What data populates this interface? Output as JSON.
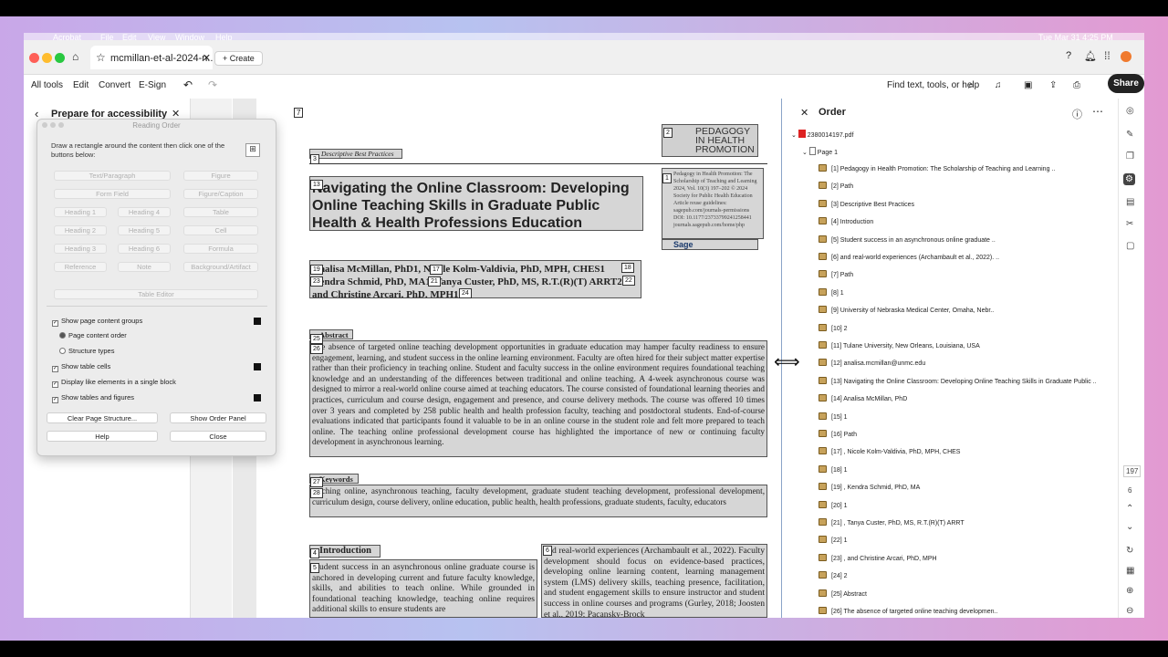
{
  "menubar": {
    "items": [
      "Acrobat",
      "File",
      "Edit",
      "View",
      "Window",
      "Help"
    ],
    "clock": "Tue Mar 31 4:25 PM"
  },
  "tab": {
    "title": "mcmillan-et-al-2024-n...",
    "new_tab": "Create"
  },
  "toolbar": {
    "all_tools": "All tools",
    "edit": "Edit",
    "convert": "Convert",
    "esign": "E-Sign",
    "search": "Find text, tools, or help",
    "share": "Share"
  },
  "left_panel": {
    "title": "Prepare for accessibility"
  },
  "reading_order": {
    "title": "Reading Order",
    "instruction": "Draw a rectangle around the content then click one of the buttons below:",
    "buttons": [
      "Text/Paragraph",
      "Figure",
      "Form Field",
      "Figure/Caption",
      "Heading 1",
      "Heading 4",
      "Table",
      "Heading 2",
      "Heading 5",
      "Cell",
      "Heading 3",
      "Heading 6",
      "Formula",
      "Reference",
      "Note",
      "Background/Artifact"
    ],
    "table_editor": "Table Editor",
    "options": {
      "show_groups": "Show page content groups",
      "content_order": "Page content order",
      "structure_types": "Structure types",
      "show_cells": "Show table cells",
      "display_like": "Display like elements in a single block",
      "show_tables": "Show tables and figures"
    },
    "clear": "Clear Page Structure...",
    "show_order": "Show Order Panel",
    "help": "Help",
    "close": "Close"
  },
  "document": {
    "page_number": "7",
    "best_practices": "Descriptive Best Practices",
    "journal_title": "PEDAGOGY IN HEALTH PROMOTION",
    "journal_info": "Pedagogy in Health Promotion: The Scholarship of Teaching and Learning 2024, Vol. 10(3) 197–202 © 2024 Society for Public Health Education Article reuse guidelines: sagepub.com/journals-permissions DOI: 10.1177/23733799241258441 journals.sagepub.com/home/php",
    "sage": "Sage",
    "title": "Navigating the Online Classroom: Developing Online Teaching Skills in Graduate Public Health & Health Professions Education",
    "authors1": "Analisa McMillan, PhD1, Nicole Kolm-Valdivia, PhD, MPH, CHES1",
    "authors2": "Kendra Schmid, PhD, MA1, Tanya Custer, PhD, MS, R.T.(R)(T) ARRT2",
    "authors3": "and Christine Arcari, PhD, MPH1",
    "abstract_head": "Abstract",
    "abstract": "The absence of targeted online teaching development opportunities in graduate education may hamper faculty readiness to ensure engagement, learning, and student success in the online learning environment. Faculty are often hired for their subject matter expertise rather than their proficiency in teaching online. Student and faculty success in the online environment requires foundational teaching knowledge and an understanding of the differences between traditional and online teaching. A 4-week asynchronous course was designed to mirror a real-world online course aimed at teaching educators. The course consisted of foundational learning theories and practices, curriculum and course design, engagement and presence, and course delivery methods. The course was offered 10 times over 3 years and completed by 258 public health and health profession faculty, teaching and postdoctoral students. End-of-course evaluations indicated that participants found it valuable to be in an online course in the student role and felt more prepared to teach online. The teaching online professional development course has highlighted the importance of new or continuing faculty development in asynchronous learning.",
    "keywords_head": "Keywords",
    "keywords": "teaching online, asynchronous teaching, faculty development, graduate student teaching development, professional development, curriculum design, course delivery, online education, public health, health professions, graduate students, faculty, educators",
    "intro_head": "Introduction",
    "intro": "Student success in an asynchronous online graduate course is anchored in developing current and future faculty knowledge, skills, and abilities to teach online. While grounded in foundational teaching knowledge, teaching online requires additional skills to ensure students are",
    "col2": "and real-world experiences (Archambault et al., 2022). Faculty development should focus on evidence-based practices, developing online learning content, learning management system (LMS) delivery skills, teaching presence, facilitation, and student engagement skills to ensure instructor and student success in online courses and programs (Gurley, 2018; Joosten et al., 2019; Pacansky-Brock"
  },
  "order_panel": {
    "title": "Order",
    "file": "2380014197.pdf",
    "page": "Page 1",
    "items": [
      "[1] Pedagogy in Health Promotion: The Scholarship of Teaching and Learning ..",
      "[2] Path",
      "[3] Descriptive Best Practices",
      "[4] Introduction",
      "[5] Student success in an asynchronous online graduate ..",
      "[6] and real-world experiences (Archambault et al., 2022). ..",
      "[7] Path",
      "[8] 1",
      "[9] University of Nebraska Medical Center, Omaha, Nebr..",
      "[10] 2",
      "[11] Tulane University, New Orleans, Louisiana, USA",
      "[12] analisa.mcmillan@unmc.edu",
      "[13] Navigating the Online Classroom: Developing Online Teaching Skills in Graduate Public ..",
      "[14] Analisa McMillan, PhD",
      "[15] 1",
      "[16] Path",
      "[17] , Nicole Kolm-Valdivia, PhD, MPH, CHES",
      "[18] 1",
      "[19] , Kendra Schmid, PhD, MA",
      "[20] 1",
      "[21] , Tanya Custer, PhD, MS, R.T.(R)(T) ARRT",
      "[22] 1",
      "[23] , and Christine Arcari, PhD, MPH",
      "[24] 2",
      "[25] Abstract",
      "[26] The absence of targeted online teaching developmen.."
    ]
  },
  "rail": {
    "page_total": "197",
    "page_current": "6"
  }
}
